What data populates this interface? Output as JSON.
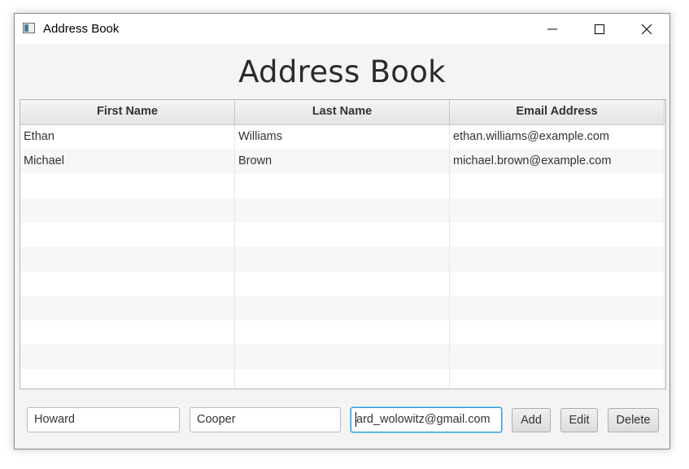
{
  "window": {
    "title": "Address Book",
    "controls": {
      "minimize": "minimize-icon",
      "maximize": "maximize-icon",
      "close": "close-icon"
    }
  },
  "main": {
    "heading": "Address Book"
  },
  "table": {
    "columns": [
      "First Name",
      "Last Name",
      "Email Address"
    ],
    "rows": [
      [
        "Ethan",
        "Williams",
        "ethan.williams@example.com"
      ],
      [
        "Michael",
        "Brown",
        "michael.brown@example.com"
      ],
      [
        "",
        "",
        ""
      ],
      [
        "",
        "",
        ""
      ],
      [
        "",
        "",
        ""
      ],
      [
        "",
        "",
        ""
      ],
      [
        "",
        "",
        ""
      ],
      [
        "",
        "",
        ""
      ],
      [
        "",
        "",
        ""
      ],
      [
        "",
        "",
        ""
      ],
      [
        "",
        "",
        ""
      ]
    ]
  },
  "form": {
    "first_name_value": "Howard",
    "last_name_value": "Cooper",
    "email_value": "ard_wolowitz@gmail.com",
    "add_label": "Add",
    "edit_label": "Edit",
    "delete_label": "Delete"
  },
  "colors": {
    "focus_border": "#2f9bd8",
    "header_bg": "#e8e8e8",
    "window_bg": "#f4f4f4"
  }
}
